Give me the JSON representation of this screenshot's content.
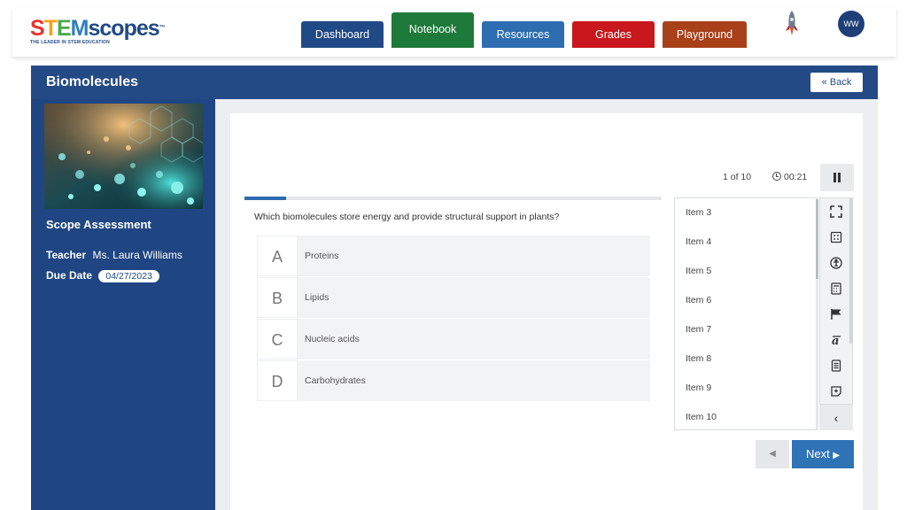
{
  "header": {
    "logo": {
      "text": "STEMscopes",
      "tagline": "THE LEADER IN STEM EDUCATION",
      "tm": "™"
    },
    "tabs": [
      {
        "label": "Dashboard",
        "color": "#204a86"
      },
      {
        "label": "Notebook",
        "color": "#1e7a3a"
      },
      {
        "label": "Resources",
        "color": "#2d6db0"
      },
      {
        "label": "Grades",
        "color": "#c8171d"
      },
      {
        "label": "Playground",
        "color": "#a8401a"
      }
    ],
    "avatar_initials": "WW"
  },
  "titlebar": {
    "title": "Biomolecules",
    "back_label": "Back",
    "back_icon": "double-chevron-left-icon"
  },
  "sidebar": {
    "assessment_label": "Scope Assessment",
    "teacher_label": "Teacher",
    "teacher_name": "Ms. Laura Williams",
    "due_label": "Due Date",
    "due_date": "04/27/2023"
  },
  "assessment": {
    "counter": "1 of 10",
    "timer": "00:21",
    "progress": 0.1,
    "question": "Which biomolecules store energy and provide structural support in plants?",
    "options": [
      {
        "letter": "A",
        "text": "Proteins"
      },
      {
        "letter": "B",
        "text": "Lipids"
      },
      {
        "letter": "C",
        "text": "Nucleic acids"
      },
      {
        "letter": "D",
        "text": "Carbohydrates"
      }
    ],
    "items": [
      "Item 3",
      "Item 4",
      "Item 5",
      "Item 6",
      "Item 7",
      "Item 8",
      "Item 9",
      "Item 10"
    ],
    "tools": [
      "fullscreen-icon",
      "reference-sheet-icon",
      "accessibility-icon",
      "calculator-icon",
      "flag-icon",
      "text-to-speech-icon",
      "notepad-icon",
      "note-add-icon"
    ],
    "collapse_icon": "chevron-left-icon",
    "prev_icon": "caret-left-icon",
    "next_label": "Next",
    "next_icon": "caret-right-icon"
  },
  "colors": {
    "primary": "#1f4682",
    "accent": "#2f73b7"
  }
}
